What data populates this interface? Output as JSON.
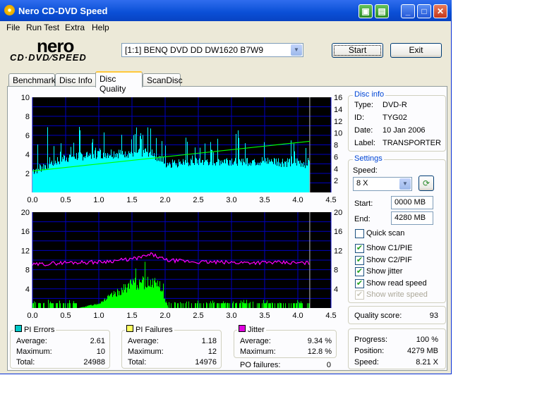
{
  "window": {
    "title": "Nero CD-DVD Speed"
  },
  "menu": [
    "File",
    "Run Test",
    "Extra",
    "Help"
  ],
  "logo": {
    "line1": "nero",
    "line2": "CD·DVD∕SPEED"
  },
  "drive": {
    "selected": "[1:1]  BENQ DVD DD DW1620 B7W9"
  },
  "buttons": {
    "start": "Start",
    "exit": "Exit"
  },
  "tabs": [
    "Benchmark",
    "Disc Info",
    "Disc Quality",
    "ScanDisc"
  ],
  "disc_info": {
    "title": "Disc info",
    "type_label": "Type:",
    "type": "DVD-R",
    "id_label": "ID:",
    "id": "TYG02",
    "date_label": "Date:",
    "date": "10 Jan 2006",
    "label_label": "Label:",
    "label": "TRANSPORTER"
  },
  "settings": {
    "title": "Settings",
    "speed_label": "Speed:",
    "speed": "8 X",
    "start_label": "Start:",
    "start": "0000 MB",
    "end_label": "End:",
    "end": "4280 MB",
    "checks": [
      {
        "label": "Quick scan",
        "checked": false,
        "disabled": false
      },
      {
        "label": "Show C1/PIE",
        "checked": true,
        "disabled": false
      },
      {
        "label": "Show C2/PIF",
        "checked": true,
        "disabled": false
      },
      {
        "label": "Show jitter",
        "checked": true,
        "disabled": false
      },
      {
        "label": "Show read speed",
        "checked": true,
        "disabled": false
      },
      {
        "label": "Show write speed",
        "checked": true,
        "disabled": true
      }
    ]
  },
  "quality": {
    "label": "Quality score:",
    "value": "93"
  },
  "progress": {
    "progress_label": "Progress:",
    "progress": "100 %",
    "position_label": "Position:",
    "position": "4279 MB",
    "speed_label": "Speed:",
    "speed": "8.21 X"
  },
  "stats": {
    "pi_errors": {
      "title": "PI Errors",
      "avg_label": "Average:",
      "avg": "2.61",
      "max_label": "Maximum:",
      "max": "10",
      "total_label": "Total:",
      "total": "24988"
    },
    "pi_failures": {
      "title": "PI Failures",
      "avg_label": "Average:",
      "avg": "1.18",
      "max_label": "Maximum:",
      "max": "12",
      "total_label": "Total:",
      "total": "14976"
    },
    "jitter": {
      "title": "Jitter",
      "avg_label": "Average:",
      "avg": "9.34 %",
      "max_label": "Maximum:",
      "max": "12.8 %"
    },
    "po_failures": {
      "label": "PO failures:",
      "value": "0"
    }
  },
  "colors": {
    "pie": "#00ffff",
    "pif": "#00ff00",
    "jitter": "#ff00ff",
    "speed": "#00ff00",
    "bg": "#000000",
    "grid": "#0000c0"
  },
  "chart_data": [
    {
      "type": "bar",
      "name": "PI Errors",
      "x_ticks": [
        "0.0",
        "0.5",
        "1.0",
        "1.5",
        "2.0",
        "2.5",
        "3.0",
        "3.5",
        "4.0",
        "4.5"
      ],
      "y_left_ticks": [
        "2",
        "4",
        "6",
        "8",
        "10"
      ],
      "y_right_ticks": [
        "2",
        "4",
        "6",
        "8",
        "10",
        "12",
        "14",
        "16"
      ],
      "xlim": [
        0,
        4.5
      ],
      "ylim": [
        0,
        10
      ],
      "y2lim": [
        0,
        16
      ],
      "end_marker_x": 4.18,
      "pie_profile": {
        "x": [
          0,
          0.5,
          1.0,
          1.5,
          1.8,
          2.0,
          2.5,
          3.0,
          3.5,
          4.0,
          4.18
        ],
        "baseline": [
          2.2,
          3.6,
          4.0,
          4.1,
          4.2,
          3.0,
          3.2,
          3.3,
          3.2,
          3.1,
          3.0
        ],
        "peaks": [
          6.8,
          7.2,
          6.7,
          6.9,
          8.1,
          6.4,
          5.6,
          6.6,
          6.3,
          6.0,
          5.5
        ]
      },
      "read_speed": {
        "x": [
          0,
          4.18
        ],
        "y2": [
          3.6,
          8.6
        ]
      }
    },
    {
      "type": "bar",
      "name": "PI Failures",
      "x_ticks": [
        "0.0",
        "0.5",
        "1.0",
        "1.5",
        "2.0",
        "2.5",
        "3.0",
        "3.5",
        "4.0",
        "4.5"
      ],
      "y_left_ticks": [
        "4",
        "8",
        "12",
        "16",
        "20"
      ],
      "y_right_ticks": [
        "4",
        "8",
        "12",
        "16",
        "20"
      ],
      "xlim": [
        0,
        4.5
      ],
      "ylim": [
        0,
        20
      ],
      "y2lim": [
        0,
        20
      ],
      "end_marker_x": 4.18,
      "pif_profile": {
        "x": [
          0,
          0.7,
          1.0,
          1.1,
          1.3,
          1.5,
          1.8,
          1.9,
          2.05,
          4.18
        ],
        "baseline": [
          0,
          0,
          1.0,
          2.0,
          3.5,
          5.2,
          5.8,
          5.5,
          0,
          0
        ],
        "peaks": [
          1.2,
          1.6,
          2.5,
          4.0,
          6.0,
          10.5,
          12.0,
          9.5,
          0.8,
          1.5
        ]
      },
      "jitter": {
        "x": [
          0,
          0.5,
          1.0,
          1.5,
          1.7,
          1.8,
          2.0,
          2.5,
          3.0,
          3.5,
          4.0,
          4.18
        ],
        "y": [
          9.0,
          9.5,
          9.6,
          10.2,
          10.8,
          11.2,
          10.0,
          9.6,
          9.5,
          9.5,
          9.4,
          9.4
        ]
      }
    }
  ]
}
